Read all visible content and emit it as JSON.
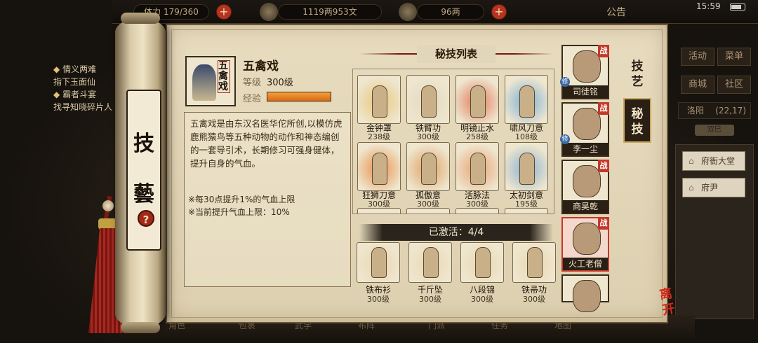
{
  "topbar": {
    "stamina": "179/360",
    "stamina_prefix": "体力",
    "money": "1119两953文",
    "ingot": "96两",
    "notice": "公告",
    "clock": "15:59"
  },
  "quest": {
    "items": [
      {
        "title": "情义两难",
        "detail": "指下玉面仙"
      },
      {
        "title": "霸者斗宴",
        "detail": "找寻知晓碎片人"
      }
    ]
  },
  "right_menu": {
    "buttons": [
      "活动",
      "菜单",
      "商城",
      "社区"
    ],
    "city": "洛阳",
    "coords": "(22,17)",
    "city_sub": "双巳",
    "locations": [
      "府衙大堂",
      "府尹"
    ]
  },
  "dock": {
    "items": [
      "角色",
      "包裹",
      "武学",
      "布阵",
      "门派",
      "任务",
      "地图"
    ]
  },
  "scroll": {
    "title_chars": [
      "技",
      "藝"
    ],
    "help": "?"
  },
  "skill": {
    "name": "五禽戏",
    "icon_text": "五禽戏",
    "level_label": "等级",
    "level_value": "300级",
    "exp_label": "经验",
    "exp_fraction": 1.0,
    "description": "五禽戏是由东汉名医华佗所创,以模仿虎鹿熊猿鸟等五种动物的动作和神态编创的一套导引术，长期修习可强身健体，提升自身的气血。",
    "notes": [
      "※每30点提升1%的气血上限",
      "※当前提升气血上限：10%"
    ]
  },
  "list": {
    "title": "秘技列表",
    "cards": [
      {
        "name": "金钟罩",
        "level": "238级",
        "color": "#e8c87a"
      },
      {
        "name": "铁臂功",
        "level": "300级",
        "color": "#e3d9be"
      },
      {
        "name": "明镜止水",
        "level": "258级",
        "color": "#e07a5a"
      },
      {
        "name": "啸风刀意",
        "level": "108级",
        "color": "#7ab0d8"
      },
      {
        "name": "狂狮刀意",
        "level": "300级",
        "color": "#e8904a"
      },
      {
        "name": "孤傲意",
        "level": "300级",
        "color": "#e0a060"
      },
      {
        "name": "活脉法",
        "level": "300级",
        "color": "#e8a070"
      },
      {
        "name": "太初剑意",
        "level": "195级",
        "color": "#8ab0d0"
      }
    ],
    "activated_label": "已激活：4/4",
    "activated": [
      {
        "name": "铁布衫",
        "level": "300级"
      },
      {
        "name": "千斤坠",
        "level": "300级"
      },
      {
        "name": "八段锦",
        "level": "300级"
      },
      {
        "name": "铁帚功",
        "level": "300级"
      }
    ]
  },
  "tabs": [
    {
      "label": "技艺",
      "active": false
    },
    {
      "label": "秘技",
      "active": true
    }
  ],
  "heroes": [
    {
      "name": "司徒铭",
      "badge": "战"
    },
    {
      "name": "李一尘",
      "badge": "战"
    },
    {
      "name": "商昊乾",
      "badge": "战"
    },
    {
      "name": "火工老僧",
      "badge": "战"
    }
  ],
  "hero_marker": "修",
  "leave": "离开"
}
